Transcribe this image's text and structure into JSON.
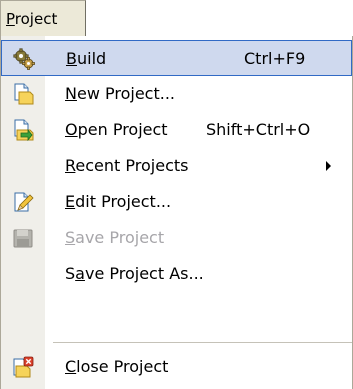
{
  "menubar": {
    "project_label": "Project",
    "project_mnemonic": "P"
  },
  "menu": {
    "items": [
      {
        "mnemonic": "B",
        "rest": "uild",
        "shortcut": "Ctrl+F9",
        "icon": "gears-icon",
        "selected": true,
        "disabled": false
      },
      {
        "mnemonic": "N",
        "rest": "ew Project...",
        "icon": "new-project-icon",
        "disabled": false
      },
      {
        "mnemonic": "O",
        "rest": "pen Project",
        "shortcut": "Shift+Ctrl+O",
        "icon": "open-project-icon",
        "disabled": false
      },
      {
        "mnemonic": "R",
        "rest": "ecent Projects",
        "has_submenu": true,
        "disabled": false
      },
      {
        "mnemonic": "E",
        "rest": "dit Project...",
        "icon": "edit-project-icon",
        "disabled": false
      },
      {
        "mnemonic": "S",
        "rest": "ave Project",
        "icon": "save-project-icon",
        "disabled": true
      },
      {
        "prefix": "S",
        "mnemonic": "a",
        "rest": "ve Project As...",
        "disabled": false
      },
      {
        "mnemonic": "C",
        "rest": "lose Project",
        "icon": "close-project-icon",
        "disabled": false
      }
    ]
  },
  "colors": {
    "selection_fill": "#cfd9ee",
    "selection_border": "#316ac5",
    "disabled_text": "#a7a6aa",
    "menubar_background": "#ece9d8"
  }
}
